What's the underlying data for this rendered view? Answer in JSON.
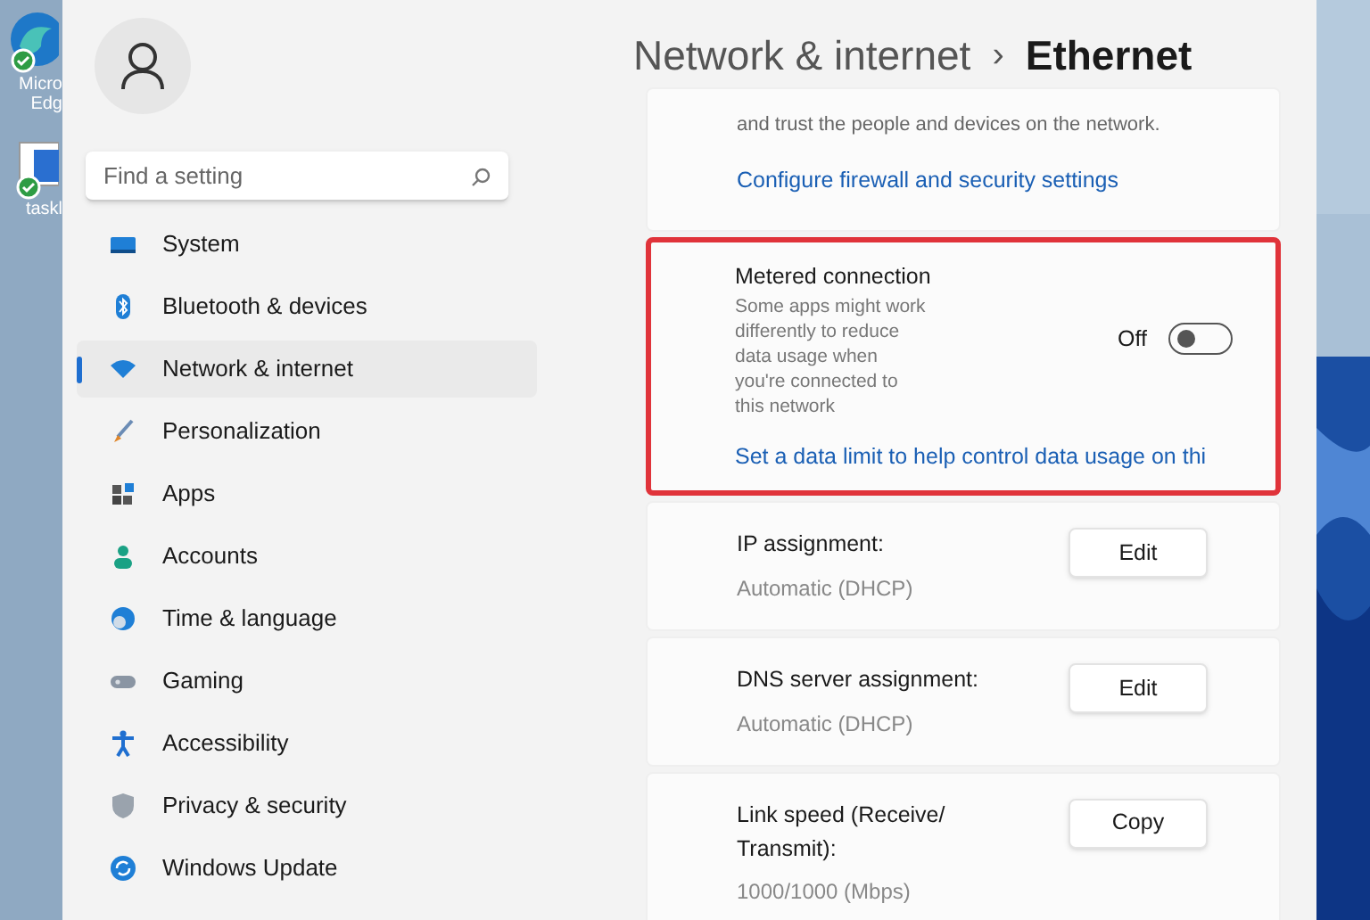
{
  "desktop": {
    "icons": [
      {
        "kind": "edge",
        "label_lines": [
          "Micro",
          "Edg"
        ]
      },
      {
        "kind": "taskbar",
        "label_lines": [
          "taskl"
        ]
      }
    ]
  },
  "sidebar": {
    "search": {
      "placeholder": "Find a setting"
    },
    "items": [
      {
        "label": "System",
        "selected": false
      },
      {
        "label": "Bluetooth & devices",
        "selected": false
      },
      {
        "label": "Network & internet",
        "selected": true
      },
      {
        "label": "Personalization",
        "selected": false
      },
      {
        "label": "Apps",
        "selected": false
      },
      {
        "label": "Accounts",
        "selected": false
      },
      {
        "label": "Time & language",
        "selected": false
      },
      {
        "label": "Gaming",
        "selected": false
      },
      {
        "label": "Accessibility",
        "selected": false
      },
      {
        "label": "Privacy & security",
        "selected": false
      },
      {
        "label": "Windows Update",
        "selected": false
      }
    ]
  },
  "breadcrumb": {
    "parent": "Network & internet",
    "separator": "›",
    "current": "Ethernet"
  },
  "cards": [
    {
      "kind": "text_link",
      "text": "and trust the people and devices on the network.",
      "link": "Configure firewall and security settings",
      "highlighted": false
    },
    {
      "kind": "toggle",
      "title": "Metered connection",
      "description": "Some apps might work differently to reduce data usage when you're connected to this network",
      "state_label": "Off",
      "on": false,
      "link": "Set a data limit to help control data usage on thi",
      "highlighted": true
    },
    {
      "kind": "button",
      "title": "IP assignment:",
      "value": "Automatic (DHCP)",
      "button": "Edit",
      "highlighted": false
    },
    {
      "kind": "button",
      "title": "DNS server assignment:",
      "value": "Automatic (DHCP)",
      "button": "Edit",
      "highlighted": false
    },
    {
      "kind": "button",
      "title": "Link speed (Receive/ Transmit):",
      "value": "1000/1000 (Mbps)",
      "button": "Copy",
      "highlighted": false
    }
  ]
}
